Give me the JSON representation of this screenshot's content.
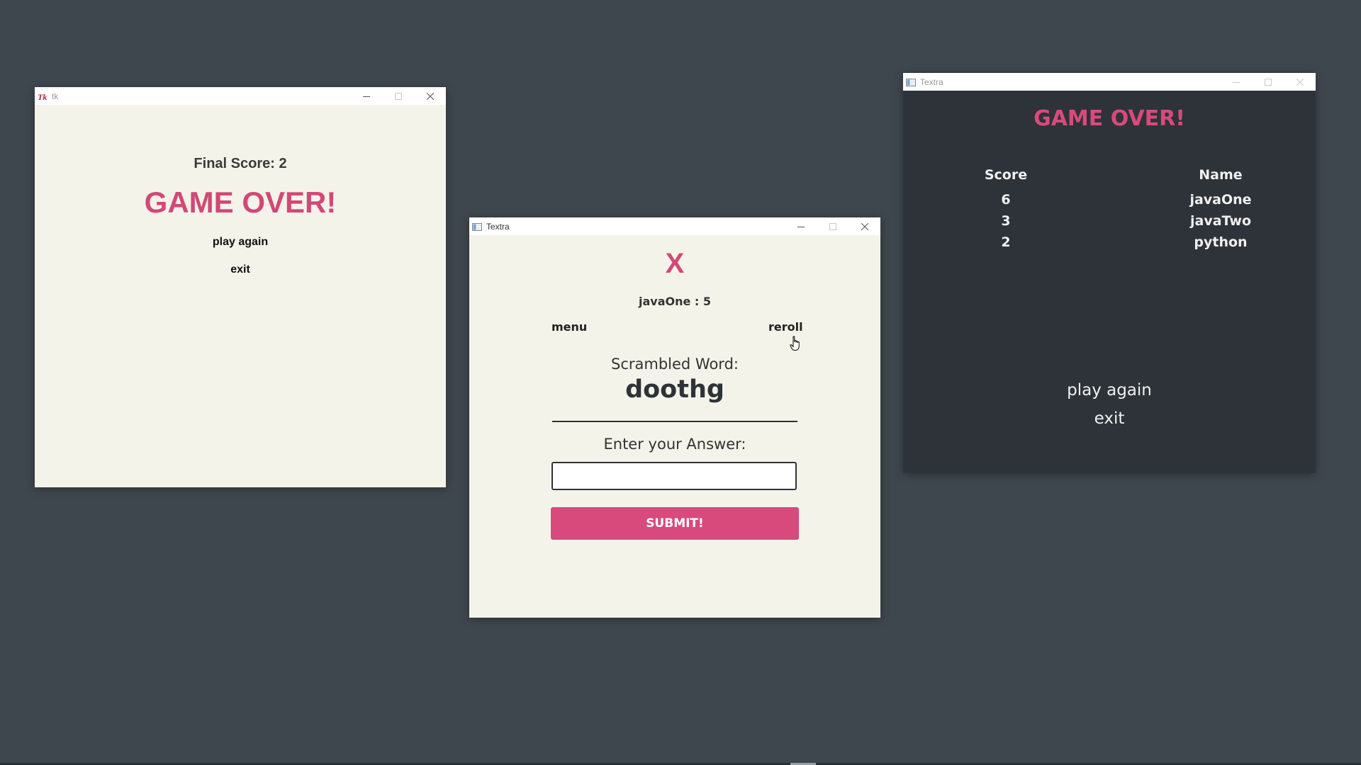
{
  "windows": {
    "tk": {
      "title": "tk",
      "final_score": "Final Score: 2",
      "game_over": "GAME OVER!",
      "play_again": "play again",
      "exit": "exit"
    },
    "game": {
      "title": "Textra",
      "mark": "X",
      "player": "javaOne : 5",
      "menu": "menu",
      "reroll": "reroll",
      "scrambled_label": "Scrambled Word:",
      "scrambled_word": "doothg",
      "answer_label": "Enter your Answer:",
      "answer_value": "",
      "submit": "SUBMIT!"
    },
    "leaderboard": {
      "title": "Textra",
      "game_over": "GAME OVER!",
      "headers": {
        "score": "Score",
        "name": "Name"
      },
      "rows": [
        {
          "score": "6",
          "name": "javaOne"
        },
        {
          "score": "3",
          "name": "javaTwo"
        },
        {
          "score": "2",
          "name": "python"
        }
      ],
      "play_again": "play again",
      "exit": "exit"
    }
  },
  "colors": {
    "desktop": "#3f474e",
    "accent_pink": "#d84a7b",
    "light_bg": "#f3f3ea",
    "dark_bg": "#2d3339"
  },
  "icons": {
    "tk_window": "tk-feather-icon",
    "textra_window": "window-app-icon",
    "minimize": "minimize-icon",
    "maximize": "maximize-icon",
    "close": "close-icon",
    "cursor": "hand-pointer-icon"
  }
}
